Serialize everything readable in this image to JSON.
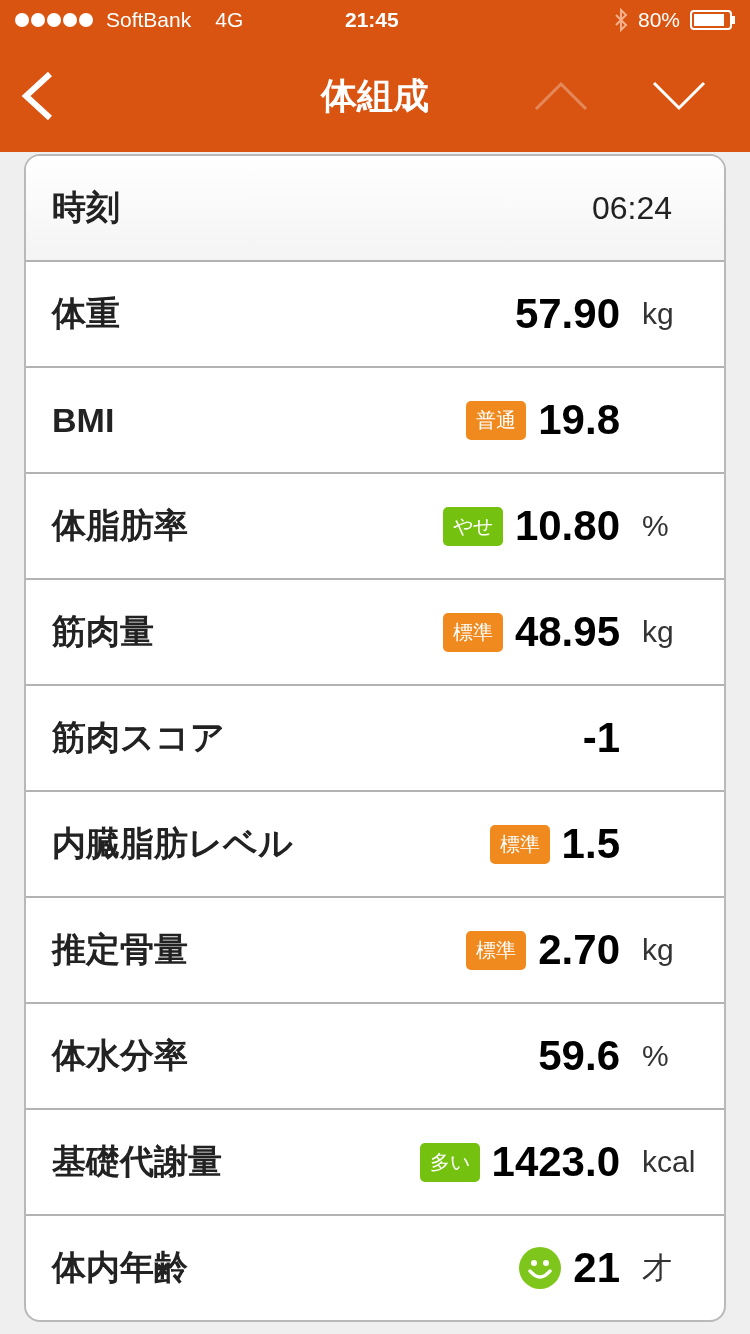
{
  "status_bar": {
    "carrier": "SoftBank",
    "network": "4G",
    "time": "21:45",
    "battery": "80%"
  },
  "nav": {
    "title": "体組成",
    "up_disabled": true,
    "down_disabled": false
  },
  "rows": [
    {
      "kind": "time",
      "label": "時刻",
      "value": "06:24"
    },
    {
      "kind": "metric",
      "label": "体重",
      "value": "57.90",
      "unit": "kg"
    },
    {
      "kind": "metric",
      "label": "BMI",
      "value": "19.8",
      "badge": {
        "text": "普通",
        "color": "#f08a1e"
      }
    },
    {
      "kind": "metric",
      "label": "体脂肪率",
      "value": "10.80",
      "unit": "%",
      "badge": {
        "text": "やせ",
        "color": "#74c20f"
      }
    },
    {
      "kind": "metric",
      "label": "筋肉量",
      "value": "48.95",
      "unit": "kg",
      "badge": {
        "text": "標準",
        "color": "#f08a1e"
      }
    },
    {
      "kind": "metric",
      "label": "筋肉スコア",
      "value": "-1"
    },
    {
      "kind": "metric",
      "label": "内臓脂肪レベル",
      "value": "1.5",
      "badge": {
        "text": "標準",
        "color": "#f08a1e"
      }
    },
    {
      "kind": "metric",
      "label": "推定骨量",
      "value": "2.70",
      "unit": "kg",
      "badge": {
        "text": "標準",
        "color": "#f08a1e"
      }
    },
    {
      "kind": "metric",
      "label": "体水分率",
      "value": "59.6",
      "unit": "%"
    },
    {
      "kind": "metric",
      "label": "基礎代謝量",
      "value": "1423.0",
      "unit": "kcal",
      "badge": {
        "text": "多い",
        "color": "#74c20f"
      }
    },
    {
      "kind": "metric",
      "label": "体内年齢",
      "value": "21",
      "unit": "才",
      "smiley": true
    }
  ]
}
